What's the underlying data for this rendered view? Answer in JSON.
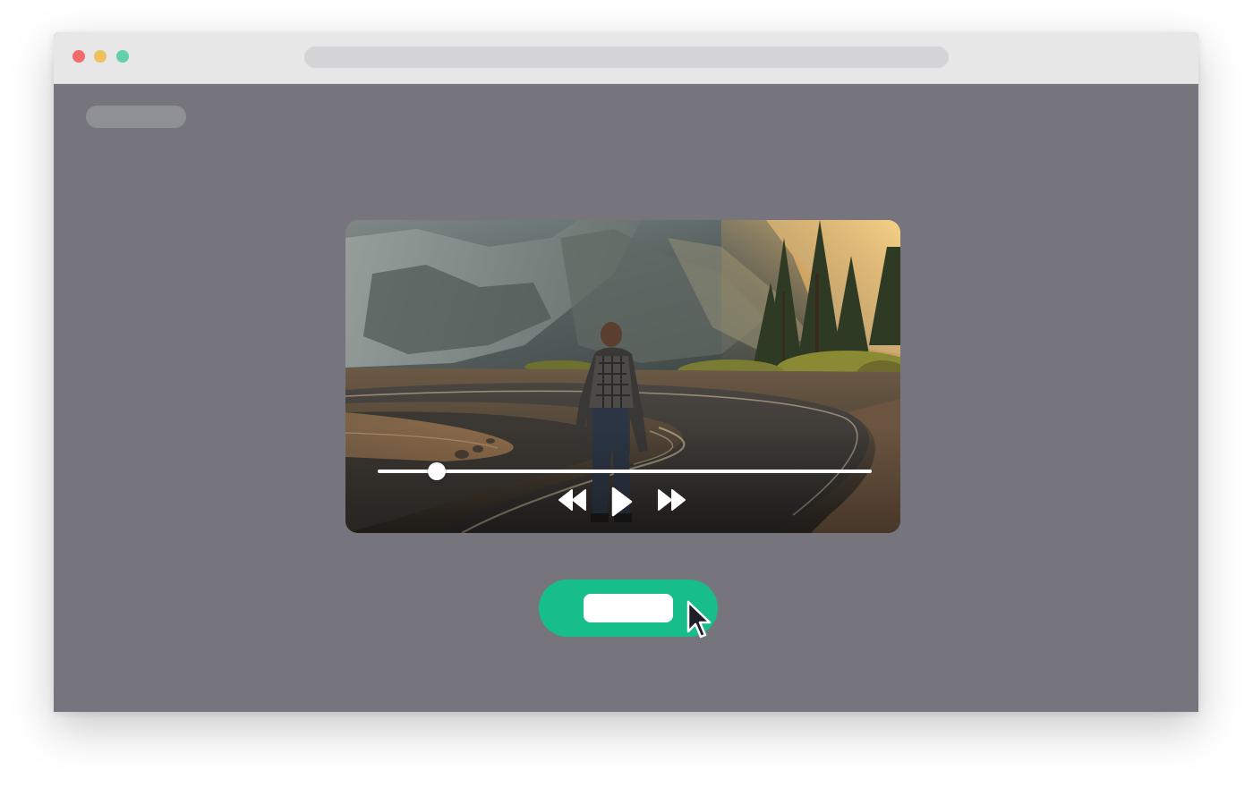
{
  "window": {
    "traffic_lights": {
      "close_color": "#f26b6b",
      "minimize_color": "#f0c05a",
      "zoom_color": "#62d0ad"
    },
    "background_color": "#76757e"
  },
  "video_player": {
    "playback_progress_fraction": 0.12,
    "controls": {
      "rewind_icon": "rewind-icon",
      "play_icon": "play-icon",
      "forward_icon": "fast-forward-icon"
    }
  },
  "cta_button": {
    "color": "#17bd8b",
    "label_placeholder_color": "#ffffff"
  },
  "cursor_icon": "arrow-cursor-icon"
}
